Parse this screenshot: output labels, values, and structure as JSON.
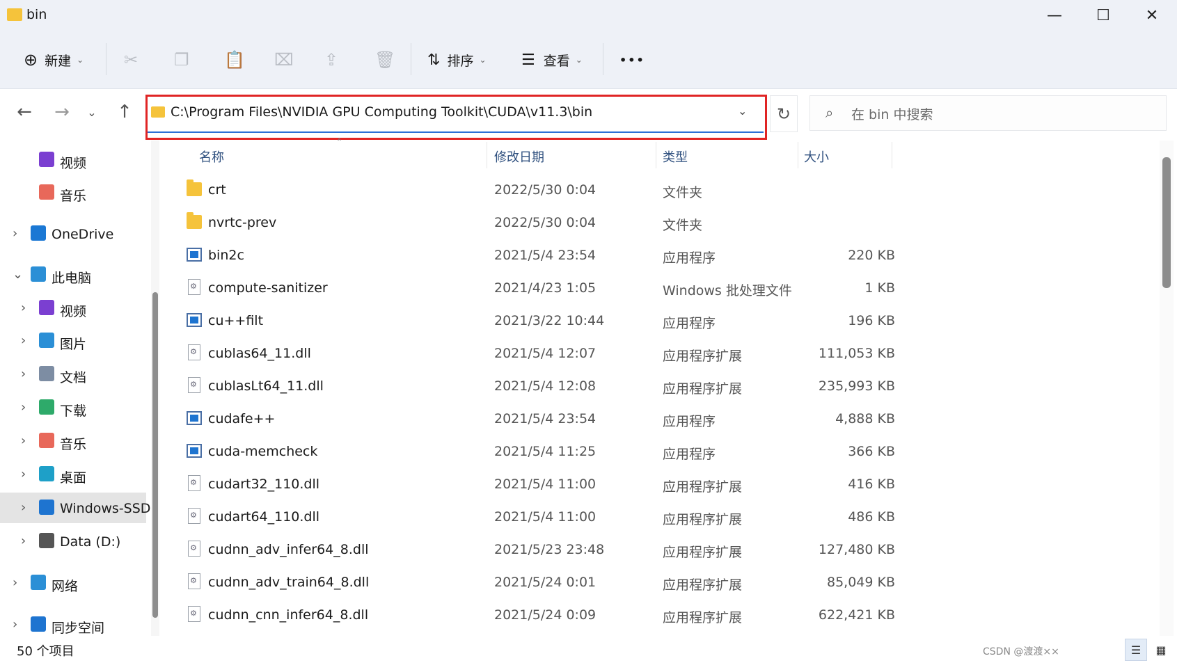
{
  "window": {
    "title": "bin"
  },
  "toolbar": {
    "new_label": "新建",
    "sort_label": "排序",
    "view_label": "查看",
    "more_label": "•••"
  },
  "address": {
    "path": "C:\\Program Files\\NVIDIA GPU Computing Toolkit\\CUDA\\v11.3\\bin",
    "search_placeholder": "在 bin 中搜索"
  },
  "sidebar": {
    "items": [
      {
        "label": "视频",
        "icon": "video-icon",
        "color": "#7b3fd1"
      },
      {
        "label": "音乐",
        "icon": "music-icon",
        "color": "#e8685a"
      },
      {
        "label": "OneDrive",
        "icon": "cloud-icon",
        "color": "#1b78d4"
      },
      {
        "label": "此电脑",
        "icon": "computer-icon",
        "color": "#2b8fd6"
      },
      {
        "label": "视频",
        "icon": "video-icon",
        "color": "#7b3fd1"
      },
      {
        "label": "图片",
        "icon": "picture-icon",
        "color": "#2b8fd6"
      },
      {
        "label": "文档",
        "icon": "document-icon",
        "color": "#7d8da3"
      },
      {
        "label": "下载",
        "icon": "download-icon",
        "color": "#2eaa6a"
      },
      {
        "label": "音乐",
        "icon": "music-icon",
        "color": "#e8685a"
      },
      {
        "label": "桌面",
        "icon": "desktop-icon",
        "color": "#1ea0c8"
      },
      {
        "label": "Windows-SSD",
        "icon": "drive-icon",
        "color": "#1e74d0"
      },
      {
        "label": "Data (D:)",
        "icon": "drive-icon",
        "color": "#555555"
      },
      {
        "label": "网络",
        "icon": "network-icon",
        "color": "#2b8fd6"
      },
      {
        "label": "同步空间",
        "icon": "sync-space-icon",
        "color": "#1e74d0"
      }
    ]
  },
  "columns": {
    "name": "名称",
    "date": "修改日期",
    "type": "类型",
    "size": "大小"
  },
  "files": [
    {
      "name": "crt",
      "date": "2022/5/30 0:04",
      "type": "文件夹",
      "size": "",
      "kind": "folder"
    },
    {
      "name": "nvrtc-prev",
      "date": "2022/5/30 0:04",
      "type": "文件夹",
      "size": "",
      "kind": "folder"
    },
    {
      "name": "bin2c",
      "date": "2021/5/4 23:54",
      "type": "应用程序",
      "size": "220 KB",
      "kind": "exe"
    },
    {
      "name": "compute-sanitizer",
      "date": "2021/4/23 1:05",
      "type": "Windows 批处理文件",
      "size": "1 KB",
      "kind": "dll"
    },
    {
      "name": "cu++filt",
      "date": "2021/3/22 10:44",
      "type": "应用程序",
      "size": "196 KB",
      "kind": "exe"
    },
    {
      "name": "cublas64_11.dll",
      "date": "2021/5/4 12:07",
      "type": "应用程序扩展",
      "size": "111,053 KB",
      "kind": "dll"
    },
    {
      "name": "cublasLt64_11.dll",
      "date": "2021/5/4 12:08",
      "type": "应用程序扩展",
      "size": "235,993 KB",
      "kind": "dll"
    },
    {
      "name": "cudafe++",
      "date": "2021/5/4 23:54",
      "type": "应用程序",
      "size": "4,888 KB",
      "kind": "exe"
    },
    {
      "name": "cuda-memcheck",
      "date": "2021/5/4 11:25",
      "type": "应用程序",
      "size": "366 KB",
      "kind": "exe"
    },
    {
      "name": "cudart32_110.dll",
      "date": "2021/5/4 11:00",
      "type": "应用程序扩展",
      "size": "416 KB",
      "kind": "dll"
    },
    {
      "name": "cudart64_110.dll",
      "date": "2021/5/4 11:00",
      "type": "应用程序扩展",
      "size": "486 KB",
      "kind": "dll"
    },
    {
      "name": "cudnn_adv_infer64_8.dll",
      "date": "2021/5/23 23:48",
      "type": "应用程序扩展",
      "size": "127,480 KB",
      "kind": "dll"
    },
    {
      "name": "cudnn_adv_train64_8.dll",
      "date": "2021/5/24 0:01",
      "type": "应用程序扩展",
      "size": "85,049 KB",
      "kind": "dll"
    },
    {
      "name": "cudnn_cnn_infer64_8.dll",
      "date": "2021/5/24 0:09",
      "type": "应用程序扩展",
      "size": "622,421 KB",
      "kind": "dll"
    }
  ],
  "status": {
    "count_text": "50 个项目",
    "watermark": "CSDN @渡渡××"
  }
}
